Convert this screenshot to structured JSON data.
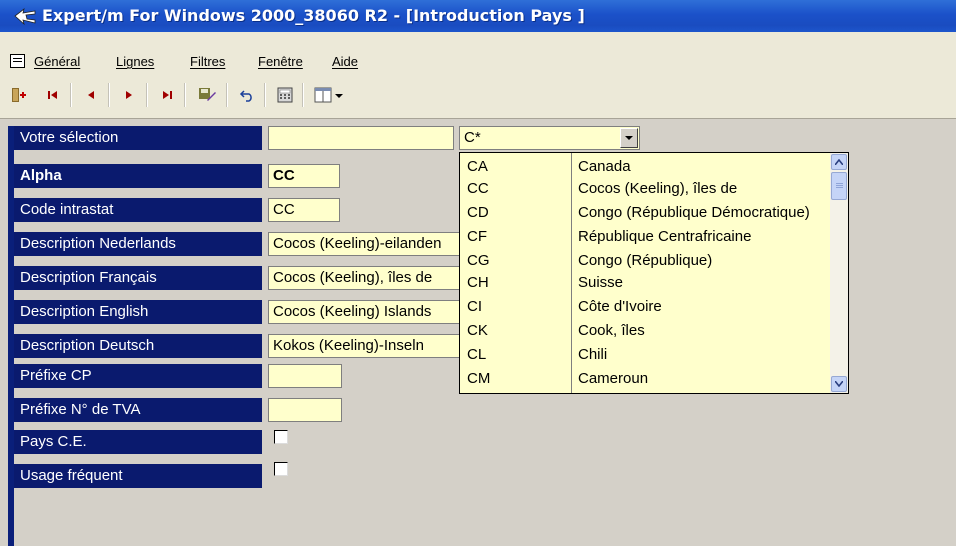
{
  "window": {
    "title": "Expert/m For Windows 2000_38060 R2 - [Introduction Pays ]"
  },
  "menu": {
    "items": [
      "Général",
      "Lignes",
      "Filtres",
      "Fenêtre",
      "Aide"
    ]
  },
  "toolbar": {
    "buttons": [
      "insert-record-icon",
      "first-record-icon",
      "previous-record-icon",
      "next-record-icon",
      "last-record-icon",
      "save-icon",
      "undo-icon",
      "calculator-icon",
      "columns-icon"
    ]
  },
  "form": {
    "selection_label": "Votre sélection",
    "selection_value": "",
    "selection_combo": "C*",
    "fields": [
      {
        "label": "Alpha",
        "value": "CC"
      },
      {
        "label": "Code intrastat",
        "value": "CC"
      },
      {
        "label": "Description Nederlands",
        "value": "Cocos (Keeling)-eilanden"
      },
      {
        "label": "Description Français",
        "value": "Cocos (Keeling), îles de"
      },
      {
        "label": "Description English",
        "value": "Cocos (Keeling) Islands"
      },
      {
        "label": "Description Deutsch",
        "value": "Kokos (Keeling)-Inseln"
      },
      {
        "label": "Préfixe CP",
        "value": ""
      },
      {
        "label": "Préfixe N° de TVA",
        "value": ""
      }
    ],
    "checkboxes": [
      {
        "label": "Pays C.E.",
        "checked": false
      },
      {
        "label": "Usage fréquent",
        "checked": false
      }
    ]
  },
  "dropdown": {
    "rows": [
      {
        "code": "CA",
        "name": "Canada"
      },
      {
        "code": "CC",
        "name": "Cocos (Keeling), îles de"
      },
      {
        "code": "CD",
        "name": "Congo (République Démocratique)"
      },
      {
        "code": "CF",
        "name": "République Centrafricaine"
      },
      {
        "code": "CG",
        "name": "Congo (République)"
      },
      {
        "code": "CH",
        "name": "Suisse"
      },
      {
        "code": "CI",
        "name": "Côte d'Ivoire"
      },
      {
        "code": "CK",
        "name": "Cook, îles"
      },
      {
        "code": "CL",
        "name": "Chili"
      },
      {
        "code": "CM",
        "name": "Cameroun"
      }
    ]
  },
  "colors": {
    "title_bar": "#1b51c9",
    "label_background": "#0a1a6e",
    "field_background": "#ffffcc",
    "form_background": "#d4d0c8"
  }
}
